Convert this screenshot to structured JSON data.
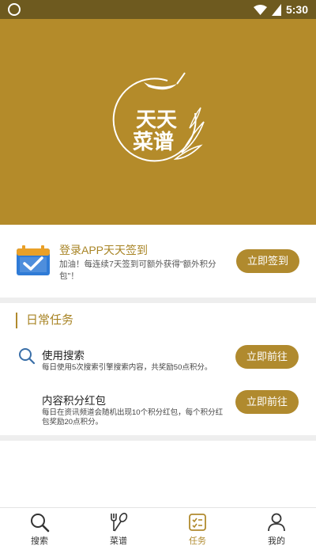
{
  "status_bar": {
    "time": "5:30",
    "icons": [
      "ring-icon",
      "wifi-icon",
      "battery-icon"
    ]
  },
  "banner": {
    "logo_text": "天天菜谱",
    "bg_color": "#b48b2a"
  },
  "signin": {
    "title": "登录APP天天签到",
    "description": "加油！每连续7天签到可额外获得\"额外积分包\"！",
    "button": "立即签到"
  },
  "daily_tasks": {
    "heading": "日常任务",
    "items": [
      {
        "title": "使用搜索",
        "description": "每日使用5次搜索引擎搜索内容，共奖励50点积分。",
        "button": "立即前往",
        "icon": "search-icon"
      },
      {
        "title": "内容积分红包",
        "description": "每日在资讯频道会随机出现10个积分红包，每个积分红包奖励20点积分。",
        "button": "立即前往",
        "icon": ""
      }
    ]
  },
  "bottom_nav": {
    "active": "任务",
    "items": [
      {
        "label": "搜索",
        "icon": "search-icon"
      },
      {
        "label": "菜谱",
        "icon": "fork-spoon-icon"
      },
      {
        "label": "任务",
        "icon": "task-list-icon"
      },
      {
        "label": "我的",
        "icon": "person-icon"
      }
    ]
  },
  "colors": {
    "accent": "#b08a2e",
    "status_bar": "#6e5a1f",
    "calendar_blue": "#2f7bd6"
  }
}
